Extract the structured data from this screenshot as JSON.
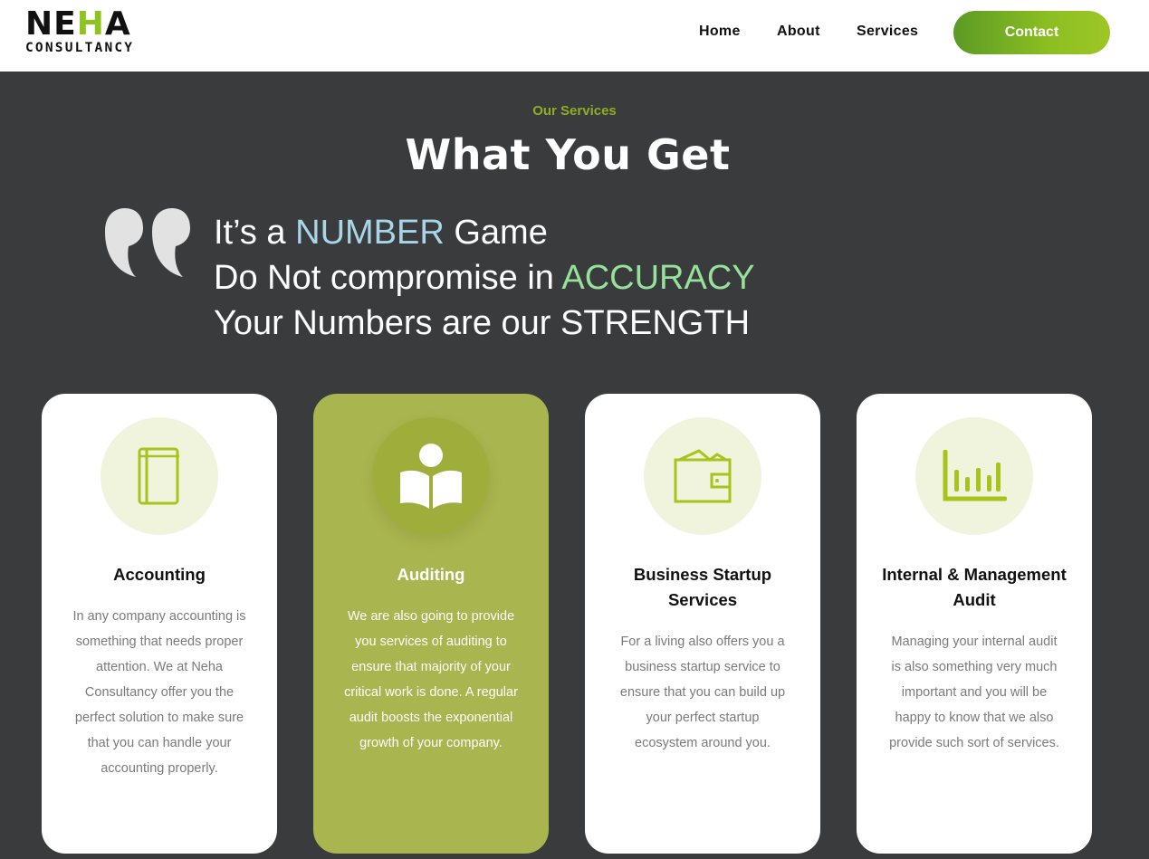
{
  "brand": {
    "logo_top_a": "NE",
    "logo_top_b": "H",
    "logo_top_c": "A",
    "logo_bottom": "CONSULTANCY"
  },
  "nav": {
    "items": [
      {
        "label": "Home"
      },
      {
        "label": "About"
      },
      {
        "label": "Services"
      }
    ],
    "contact_label": "Contact"
  },
  "intro": {
    "eyebrow": "Our Services",
    "title": "What You Get"
  },
  "quote": {
    "line1_a": "It’s a ",
    "line1_hl": "NUMBER",
    "line1_b": " Game",
    "line2_a": "Do Not compromise in ",
    "line2_hl": "ACCURACY",
    "line3": "Your Numbers are our STRENGTH"
  },
  "services": [
    {
      "title": "Accounting",
      "icon": "book-icon",
      "description": "In any company accounting is something that needs proper attention. We at Neha Consultancy offer you the perfect solution to make sure that you can handle your accounting properly."
    },
    {
      "title": "Auditing",
      "icon": "reader-book-icon",
      "description": "We are also going to provide you services of auditing to ensure that majority of your critical work is done. A regular audit boosts the exponential growth of your company."
    },
    {
      "title": "Business Startup Services",
      "icon": "wallet-icon",
      "description": "For a living also offers you a business startup service to ensure that you can build up your perfect startup ecosystem around you."
    },
    {
      "title": "Internal & Management Audit",
      "icon": "bar-chart-icon",
      "description": "Managing your internal audit is also something very much important and you will be happy to know that we also provide such sort of services."
    }
  ],
  "colors": {
    "accent": "#8fc31f",
    "background": "#3a3b3c",
    "active_card": "#a9b54e",
    "icon_green": "#a8c41c"
  }
}
